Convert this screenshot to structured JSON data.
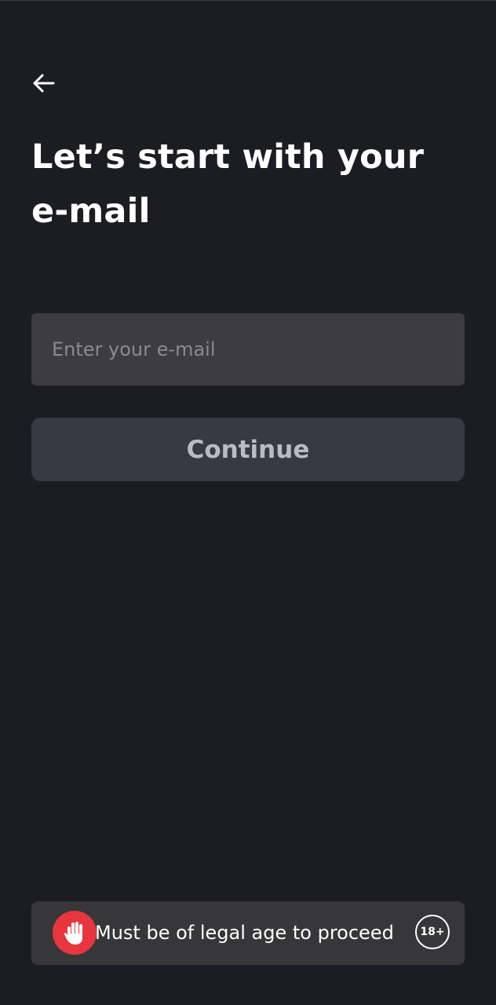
{
  "header": {
    "title": "Let’s start with your e-mail"
  },
  "form": {
    "email": {
      "value": "",
      "placeholder": "Enter your e-mail"
    },
    "continue_label": "Continue"
  },
  "age_notice": {
    "text": "Must be of legal age to proceed",
    "badge": "18+",
    "icon": "hand-stop-icon"
  },
  "colors": {
    "background": "#1c1d22",
    "input_background": "#3d3d3f",
    "button_background": "#363a43",
    "button_text": "#b9bcc2",
    "banner_background": "#37373a",
    "accent_red": "#e8363f"
  }
}
